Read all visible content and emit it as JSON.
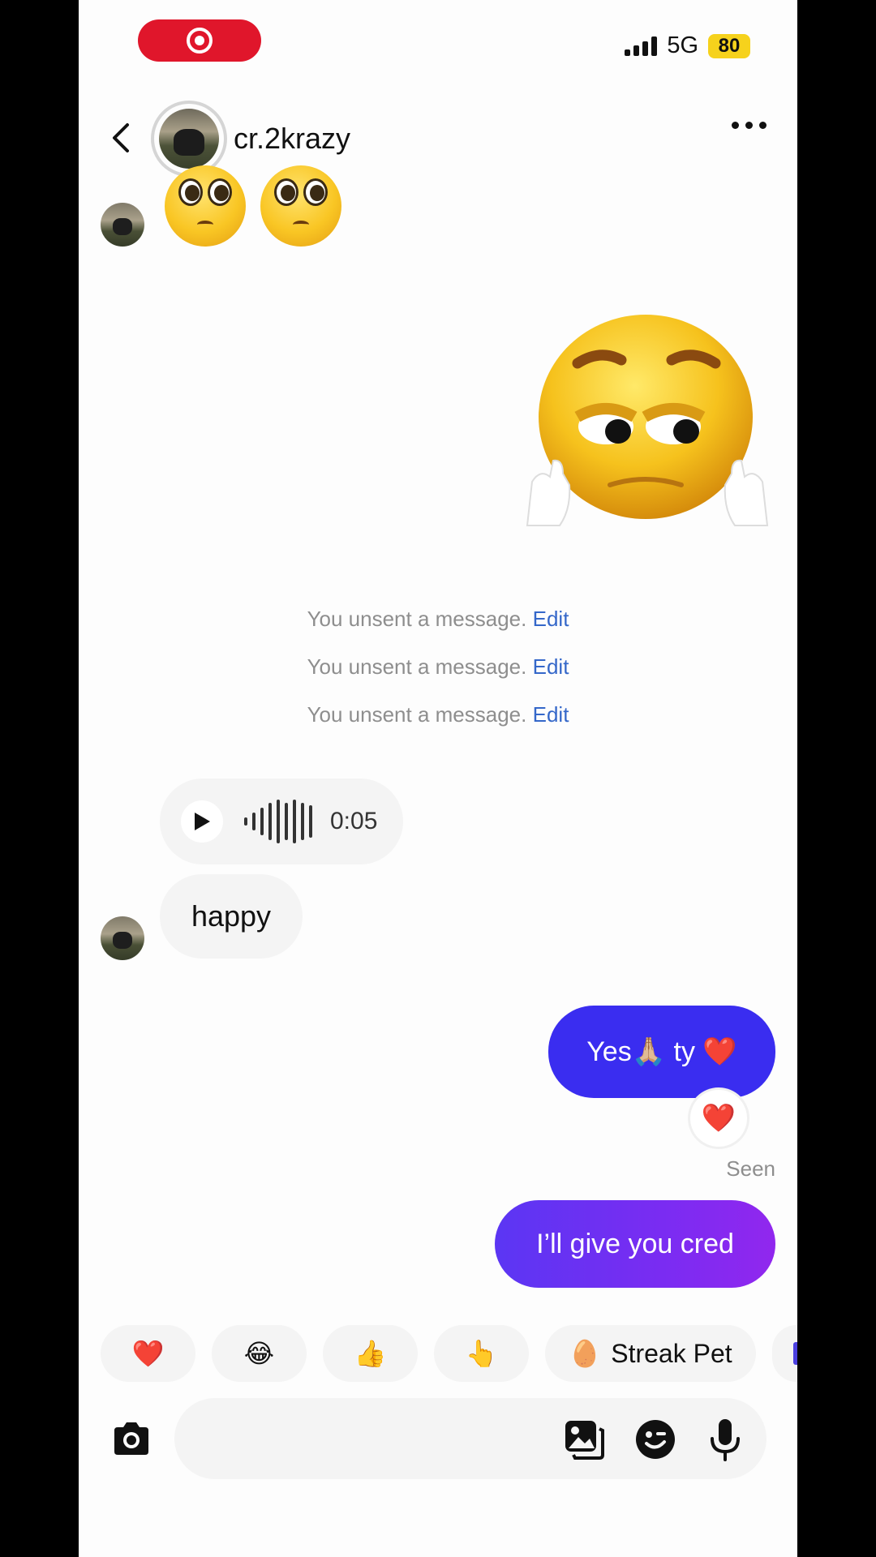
{
  "status_bar": {
    "network": "5G",
    "battery": "80"
  },
  "header": {
    "username": "cr.2krazy"
  },
  "messages": {
    "unsent_1": {
      "text": "You unsent a message.",
      "edit": "Edit"
    },
    "unsent_2": {
      "text": "You unsent a message.",
      "edit": "Edit"
    },
    "unsent_3": {
      "text": "You unsent a message.",
      "edit": "Edit"
    },
    "voice_duration": "0:05",
    "incoming_text": "happy",
    "outgoing_1": "Yes🙏🏼 ty ❤️",
    "outgoing_1_reaction": "❤️",
    "seen_label": "Seen",
    "outgoing_2": "I’ll give you cred"
  },
  "quick_replies": {
    "heart": "❤️",
    "laugh": "😂",
    "thumbs": "👍",
    "point": "👆",
    "streak_pet_icon": "🥚",
    "streak_pet": "Streak Pet"
  },
  "composer": {
    "icons": [
      "camera-icon",
      "gallery-icon",
      "sticker-icon",
      "microphone-icon"
    ]
  }
}
